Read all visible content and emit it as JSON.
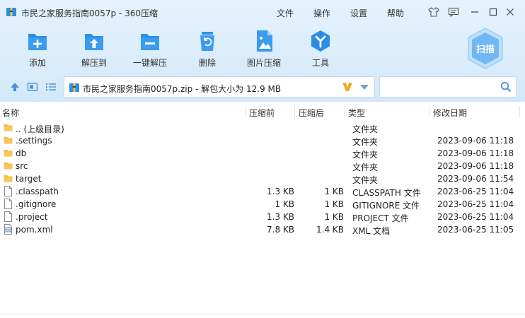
{
  "window": {
    "title": "市民之家服务指南0057p - 360压缩"
  },
  "menu": {
    "file": "文件",
    "operate": "操作",
    "settings": "设置",
    "help": "帮助"
  },
  "toolbar": {
    "add": "添加",
    "extract_to": "解压到",
    "one_click_extract": "一键解压",
    "delete": "删除",
    "image_compress": "图片压缩",
    "tools": "工具"
  },
  "scan": {
    "label": "扫描"
  },
  "address": {
    "path": "市民之家服务指南0057p.zip - 解包大小为 12.9 MB"
  },
  "search": {
    "placeholder": ""
  },
  "columns": {
    "name": "名称",
    "before": "压缩前",
    "after": "压缩后",
    "type": "类型",
    "modified": "修改日期"
  },
  "files": [
    {
      "name": ".. (上级目录)",
      "before": "",
      "after": "",
      "type": "文件夹",
      "modified": "",
      "kind": "folder"
    },
    {
      "name": ".settings",
      "before": "",
      "after": "",
      "type": "文件夹",
      "modified": "2023-09-06 11:18",
      "kind": "folder"
    },
    {
      "name": "db",
      "before": "",
      "after": "",
      "type": "文件夹",
      "modified": "2023-09-06 11:18",
      "kind": "folder"
    },
    {
      "name": "src",
      "before": "",
      "after": "",
      "type": "文件夹",
      "modified": "2023-09-06 11:18",
      "kind": "folder"
    },
    {
      "name": "target",
      "before": "",
      "after": "",
      "type": "文件夹",
      "modified": "2023-09-06 11:54",
      "kind": "folder"
    },
    {
      "name": ".classpath",
      "before": "1.3 KB",
      "after": "1 KB",
      "type": "CLASSPATH 文件",
      "modified": "2023-06-25 11:04",
      "kind": "file"
    },
    {
      "name": ".gitignore",
      "before": "1 KB",
      "after": "1 KB",
      "type": "GITIGNORE 文件",
      "modified": "2023-06-25 11:04",
      "kind": "file"
    },
    {
      "name": ".project",
      "before": "1.3 KB",
      "after": "1 KB",
      "type": "PROJECT 文件",
      "modified": "2023-06-25 11:04",
      "kind": "file"
    },
    {
      "name": "pom.xml",
      "before": "7.8 KB",
      "after": "1.4 KB",
      "type": "XML 文档",
      "modified": "2023-06-25 11:05",
      "kind": "xml"
    }
  ],
  "colors": {
    "accent": "#2a8ee6",
    "toolbar_bg": "#dbeefc",
    "folder": "#f1b83a"
  }
}
